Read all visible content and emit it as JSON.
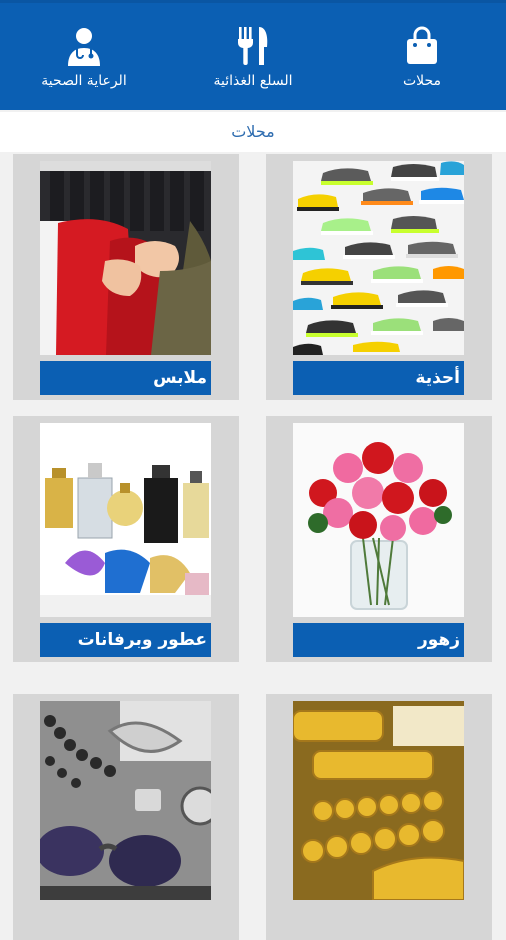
{
  "nav": {
    "items": [
      {
        "label": "محلات",
        "icon": "shopping-bag-icon"
      },
      {
        "label": "السلع الغذائية",
        "icon": "fork-knife-icon"
      },
      {
        "label": "الرعاية الصحية",
        "icon": "doctor-icon"
      }
    ]
  },
  "section": {
    "title": "محلات"
  },
  "categories": [
    {
      "label": "أحذية",
      "image": "sneakers-photo"
    },
    {
      "label": "ملابس",
      "image": "clothing-rack-photo"
    },
    {
      "label": "زهور",
      "image": "rose-bouquet-photo"
    },
    {
      "label": "عطور وبرفانات",
      "image": "perfume-bottles-photo"
    },
    {
      "label": "",
      "image": "gold-jewelry-photo"
    },
    {
      "label": "",
      "image": "accessories-photo"
    }
  ],
  "colors": {
    "primary": "#0b5fb3",
    "background": "#f1f1f1",
    "card": "#d6d6d6",
    "section_title": "#2f6db0"
  }
}
